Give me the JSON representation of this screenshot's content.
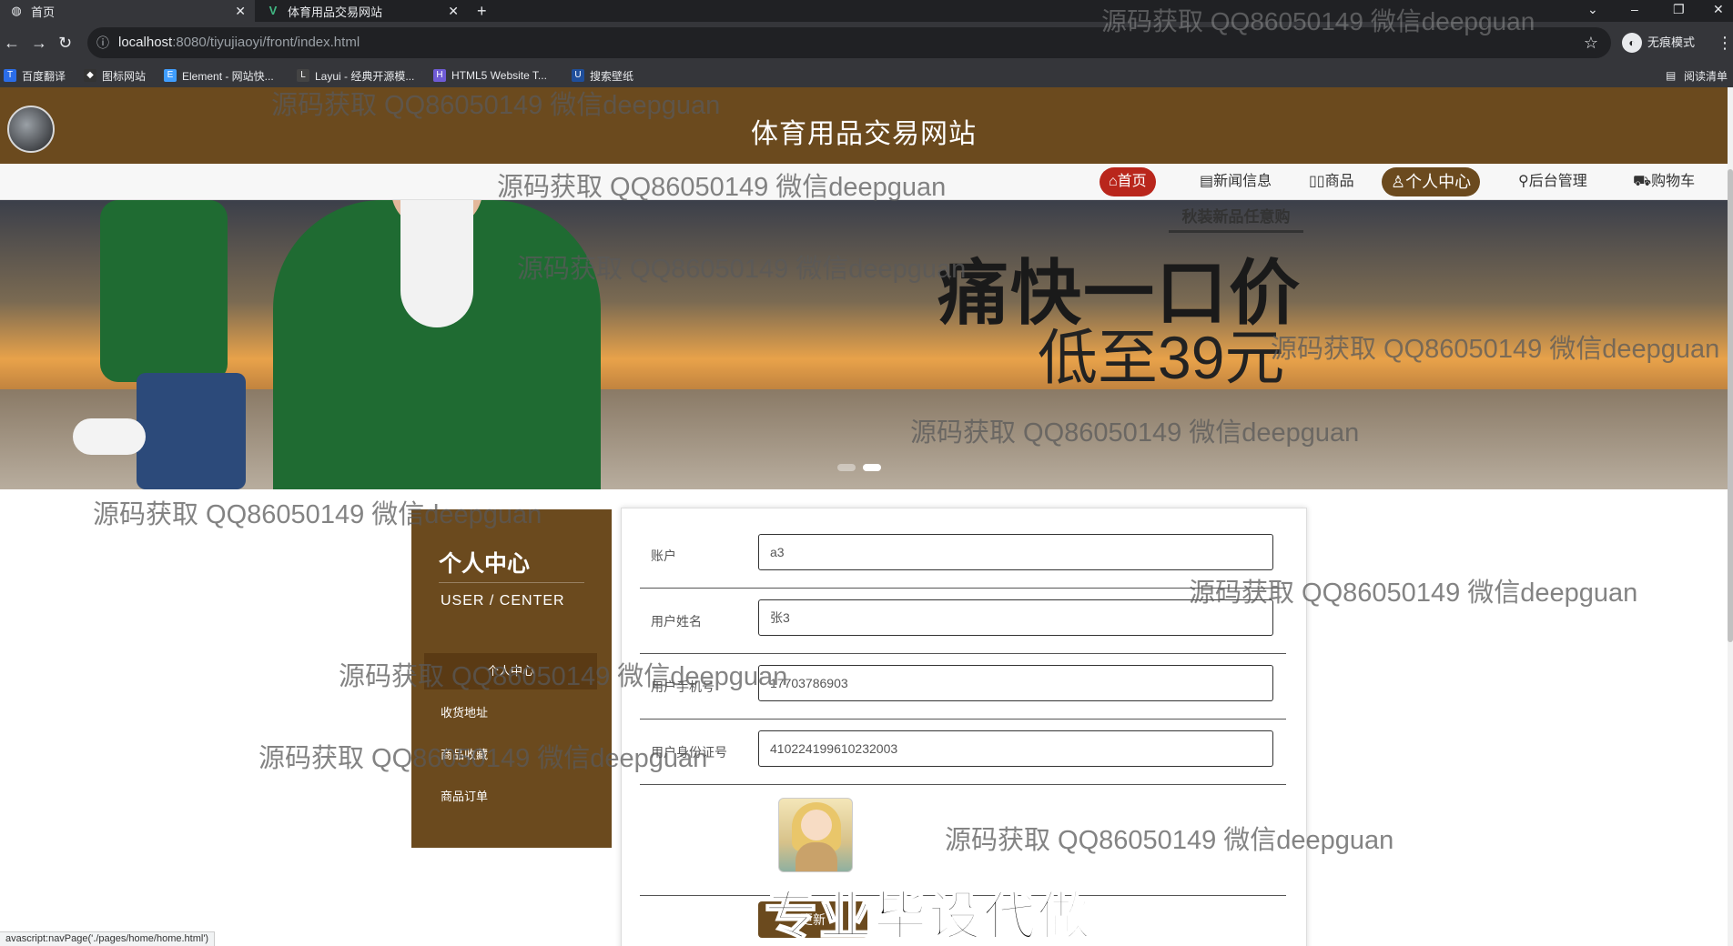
{
  "browser": {
    "tabs": [
      {
        "title": "首页",
        "favicon": "globe-icon"
      },
      {
        "title": "体育用品交易网站",
        "favicon": "vue-icon"
      }
    ],
    "url_host": "localhost",
    "url_path": ":8080/tiyujiaoyi/front/index.html",
    "incognito_label": "无痕模式",
    "bookmarks": [
      "百度翻译",
      "图标网站",
      "Element - 网站快...",
      "Layui - 经典开源模...",
      "HTML5 Website T...",
      "搜索壁纸"
    ],
    "reading_list": "阅读清单",
    "status_url": "avascript:navPage('./pages/home/home.html')"
  },
  "site": {
    "title": "体育用品交易网站",
    "nav": [
      "首页",
      "新闻信息",
      "商品",
      "个人中心",
      "后台管理",
      "购物车"
    ]
  },
  "banner": {
    "tag": "秋装新品任意购",
    "headline": "痛快一口价",
    "sub": "低至39元"
  },
  "sidebar": {
    "title": "个人中心",
    "subtitle": "USER / CENTER",
    "items": [
      "个人中心",
      "收货地址",
      "商品收藏",
      "商品订单"
    ]
  },
  "form": {
    "fields": [
      {
        "label": "账户",
        "value": "a3"
      },
      {
        "label": "用户姓名",
        "value": "张3"
      },
      {
        "label": "用户手机号",
        "value": "17703786903"
      },
      {
        "label": "用户身份证号",
        "value": "410224199610232003"
      }
    ],
    "button": "更新"
  },
  "promo": "专业毕设代做",
  "watermark": "源码获取 QQ86050149 微信deepguan",
  "colors": {
    "brand": "#6b4a1e",
    "active_nav": "#b9261c"
  }
}
